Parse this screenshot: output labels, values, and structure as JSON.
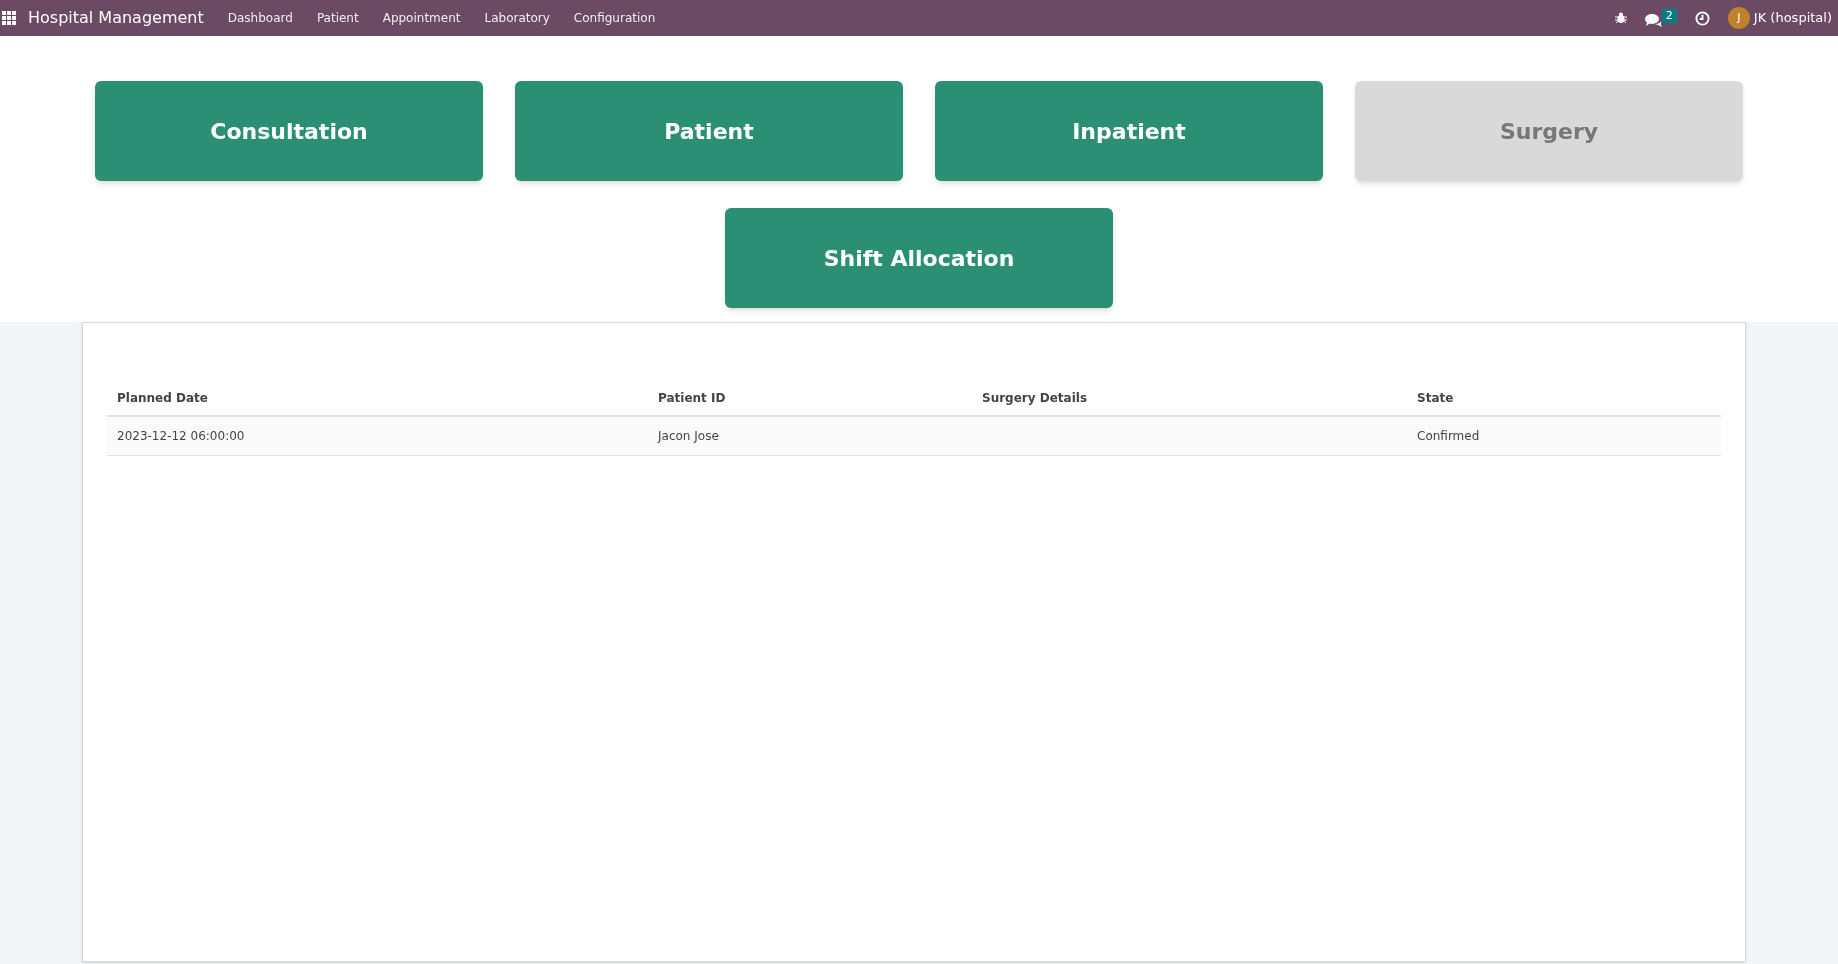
{
  "navbar": {
    "app_title": "Hospital Management",
    "menu": [
      "Dashboard",
      "Patient",
      "Appointment",
      "Laboratory",
      "Configuration"
    ],
    "message_count": "2",
    "avatar_letter": "J",
    "user": "JK (hospital)"
  },
  "tiles": [
    {
      "label": "Consultation",
      "selected": false
    },
    {
      "label": "Patient",
      "selected": false
    },
    {
      "label": "Inpatient",
      "selected": false
    },
    {
      "label": "Surgery",
      "selected": true
    },
    {
      "label": "Shift Allocation",
      "selected": false
    }
  ],
  "table": {
    "columns": [
      "Planned Date",
      "Patient ID",
      "Surgery Details",
      "State"
    ],
    "rows": [
      [
        "2023-12-12 06:00:00",
        "Jacon Jose",
        "",
        "Confirmed"
      ]
    ]
  }
}
